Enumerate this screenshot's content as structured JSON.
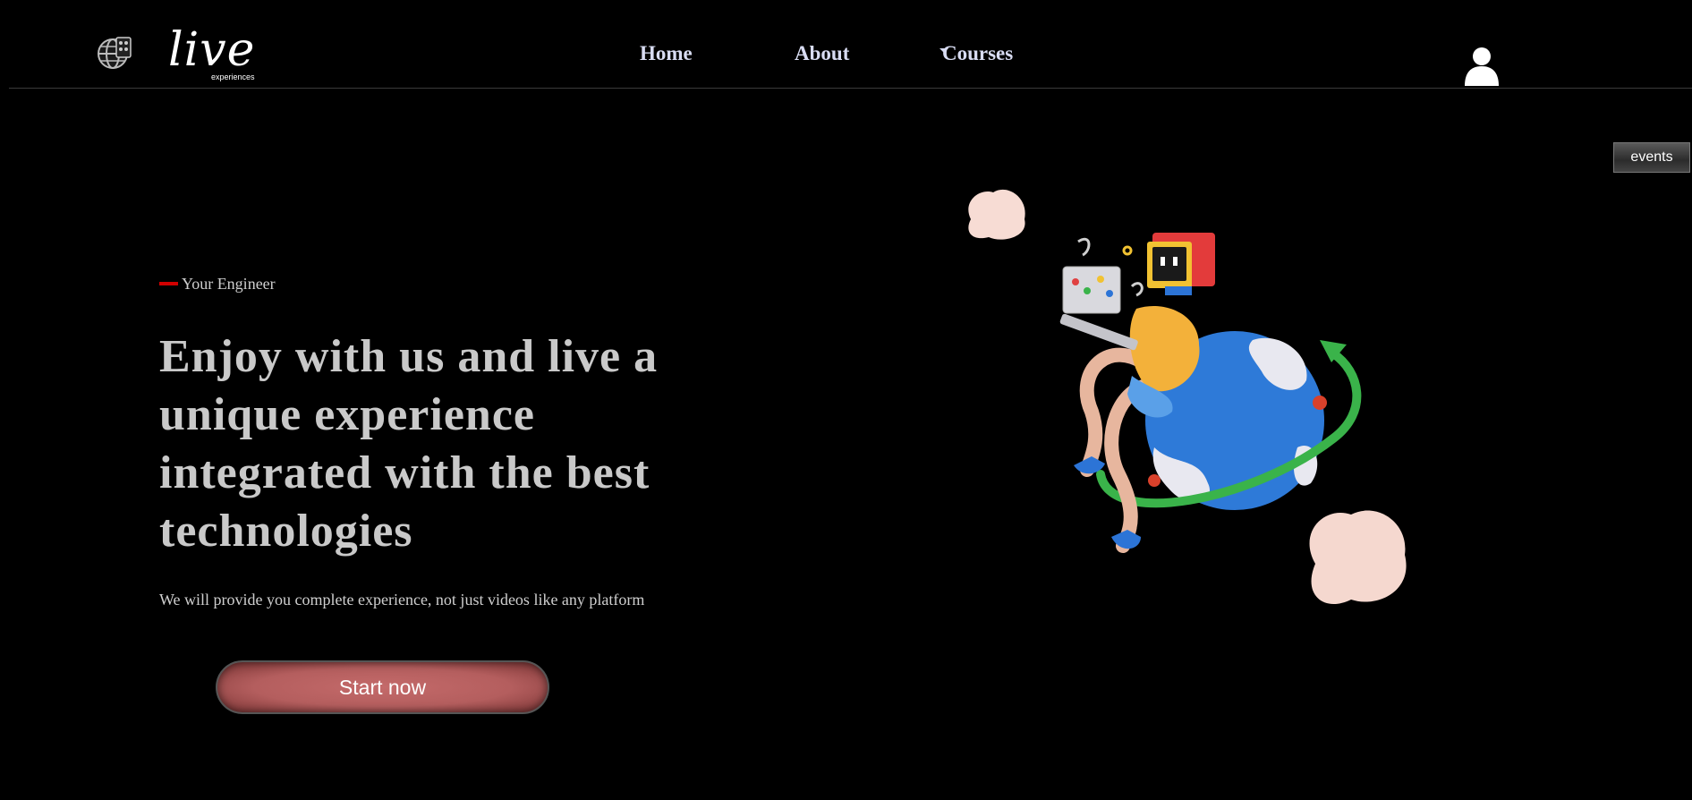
{
  "header": {
    "logo": {
      "script_text": "live",
      "sub_text": "experiences"
    },
    "nav": [
      {
        "label": "Home"
      },
      {
        "label": "About"
      },
      {
        "label": "Courses",
        "has_dropdown": true
      }
    ],
    "user_icon": "user-icon"
  },
  "side_tab": {
    "label": "events"
  },
  "hero": {
    "eyebrow": "Your Engineer",
    "headline": "Enjoy with us and live a unique experience integrated with the best technologies",
    "subtext": "We will provide you complete experience, not just videos like any platform",
    "cta_label": "Start now",
    "illustration": "globe-character-illustration"
  },
  "colors": {
    "background": "#000000",
    "nav_text": "#d8dcf2",
    "accent_red": "#d00000",
    "cta_fill": "#b45e5e",
    "text_gray": "#c9c9c9"
  }
}
